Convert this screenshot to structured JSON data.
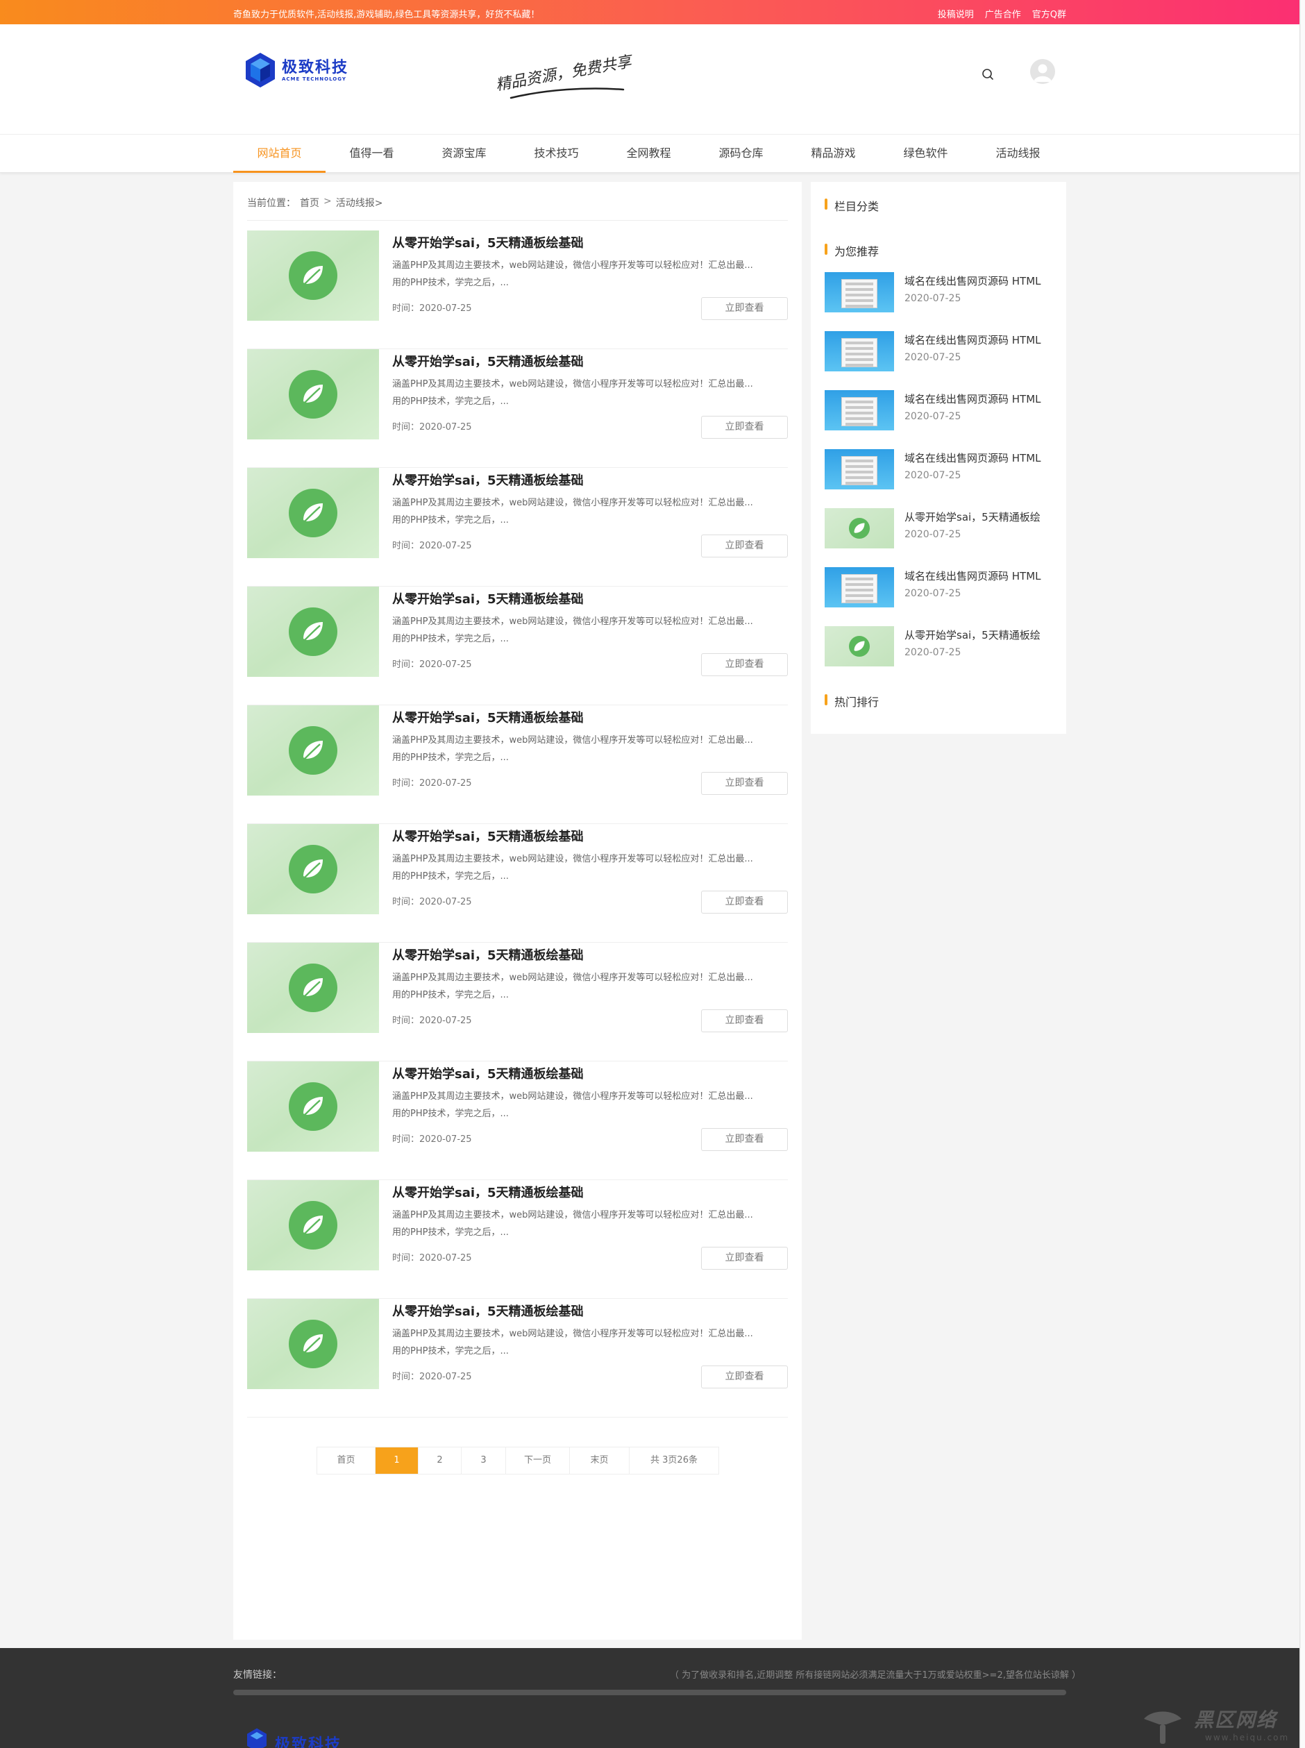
{
  "topbar": {
    "slogan": "奇鱼致力于优质软件,活动线报,游戏辅助,绿色工具等资源共享，好货不私藏！",
    "links": [
      "投稿说明",
      "广告合作",
      "官方Q群"
    ],
    "colors": {
      "start": "#f98b1d",
      "end": "#fb2f72"
    }
  },
  "header": {
    "logo_cn": "极致科技",
    "logo_en": "ACME TECHNOLOGY",
    "motto": "精品资源，免费共享",
    "search_icon": "search-icon",
    "avatar_icon": "user-avatar-icon"
  },
  "nav": {
    "items": [
      "网站首页",
      "值得一看",
      "资源宝库",
      "技术技巧",
      "全网教程",
      "源码仓库",
      "精品游戏",
      "绿色软件",
      "活动线报"
    ],
    "active_index": 0,
    "accent": "#f7931e"
  },
  "breadcrumb": {
    "label": "当前位置：",
    "home": "首页",
    "sep": ">",
    "current": "活动线报>"
  },
  "articles": [
    {
      "title": "从零开始学sai，5天精通板绘基础",
      "desc1": "涵盖PHP及其周边主要技术，web网站建设，微信小程序开发等可以轻松应对！汇总出最...",
      "desc2": "用的PHP技术，学完之后，...",
      "date": "时间：2020-07-25",
      "button": "立即查看"
    },
    {
      "title": "从零开始学sai，5天精通板绘基础",
      "desc1": "涵盖PHP及其周边主要技术，web网站建设，微信小程序开发等可以轻松应对！汇总出最...",
      "desc2": "用的PHP技术，学完之后，...",
      "date": "时间：2020-07-25",
      "button": "立即查看"
    },
    {
      "title": "从零开始学sai，5天精通板绘基础",
      "desc1": "涵盖PHP及其周边主要技术，web网站建设，微信小程序开发等可以轻松应对！汇总出最...",
      "desc2": "用的PHP技术，学完之后，...",
      "date": "时间：2020-07-25",
      "button": "立即查看"
    },
    {
      "title": "从零开始学sai，5天精通板绘基础",
      "desc1": "涵盖PHP及其周边主要技术，web网站建设，微信小程序开发等可以轻松应对！汇总出最...",
      "desc2": "用的PHP技术，学完之后，...",
      "date": "时间：2020-07-25",
      "button": "立即查看"
    },
    {
      "title": "从零开始学sai，5天精通板绘基础",
      "desc1": "涵盖PHP及其周边主要技术，web网站建设，微信小程序开发等可以轻松应对！汇总出最...",
      "desc2": "用的PHP技术，学完之后，...",
      "date": "时间：2020-07-25",
      "button": "立即查看"
    },
    {
      "title": "从零开始学sai，5天精通板绘基础",
      "desc1": "涵盖PHP及其周边主要技术，web网站建设，微信小程序开发等可以轻松应对！汇总出最...",
      "desc2": "用的PHP技术，学完之后，...",
      "date": "时间：2020-07-25",
      "button": "立即查看"
    },
    {
      "title": "从零开始学sai，5天精通板绘基础",
      "desc1": "涵盖PHP及其周边主要技术，web网站建设，微信小程序开发等可以轻松应对！汇总出最...",
      "desc2": "用的PHP技术，学完之后，...",
      "date": "时间：2020-07-25",
      "button": "立即查看"
    },
    {
      "title": "从零开始学sai，5天精通板绘基础",
      "desc1": "涵盖PHP及其周边主要技术，web网站建设，微信小程序开发等可以轻松应对！汇总出最...",
      "desc2": "用的PHP技术，学完之后，...",
      "date": "时间：2020-07-25",
      "button": "立即查看"
    },
    {
      "title": "从零开始学sai，5天精通板绘基础",
      "desc1": "涵盖PHP及其周边主要技术，web网站建设，微信小程序开发等可以轻松应对！汇总出最...",
      "desc2": "用的PHP技术，学完之后，...",
      "date": "时间：2020-07-25",
      "button": "立即查看"
    },
    {
      "title": "从零开始学sai，5天精通板绘基础",
      "desc1": "涵盖PHP及其周边主要技术，web网站建设，微信小程序开发等可以轻松应对！汇总出最...",
      "desc2": "用的PHP技术，学完之后，...",
      "date": "时间：2020-07-25",
      "button": "立即查看"
    }
  ],
  "pager": {
    "first": "首页",
    "pages": [
      "1",
      "2",
      "3"
    ],
    "current": "1",
    "next": "下一页",
    "last": "末页",
    "total": "共 3页26条"
  },
  "sidebar": {
    "category_title": "栏目分类",
    "recommend_title": "为您推荐",
    "hot_title": "热门排行",
    "recommend": [
      {
        "title": "域名在线出售网页源码 HTML",
        "date": "2020-07-25",
        "thumb": "blue"
      },
      {
        "title": "域名在线出售网页源码 HTML",
        "date": "2020-07-25",
        "thumb": "blue"
      },
      {
        "title": "域名在线出售网页源码 HTML",
        "date": "2020-07-25",
        "thumb": "blue"
      },
      {
        "title": "域名在线出售网页源码 HTML",
        "date": "2020-07-25",
        "thumb": "blue"
      },
      {
        "title": "从零开始学sai，5天精通板绘",
        "date": "2020-07-25",
        "thumb": "green"
      },
      {
        "title": "域名在线出售网页源码 HTML",
        "date": "2020-07-25",
        "thumb": "blue"
      },
      {
        "title": "从零开始学sai，5天精通板绘",
        "date": "2020-07-25",
        "thumb": "green"
      }
    ]
  },
  "footer": {
    "links_label": "友情链接：",
    "note": "（ 为了做收录和排名,近期调整 所有接链网站必须满足流量大于1万或爱站权重>=2,望各位站长谅解 ）",
    "logo_cn": "极致科技",
    "watermark": "黑区网络",
    "watermark_url": "www.heiqu.com"
  }
}
